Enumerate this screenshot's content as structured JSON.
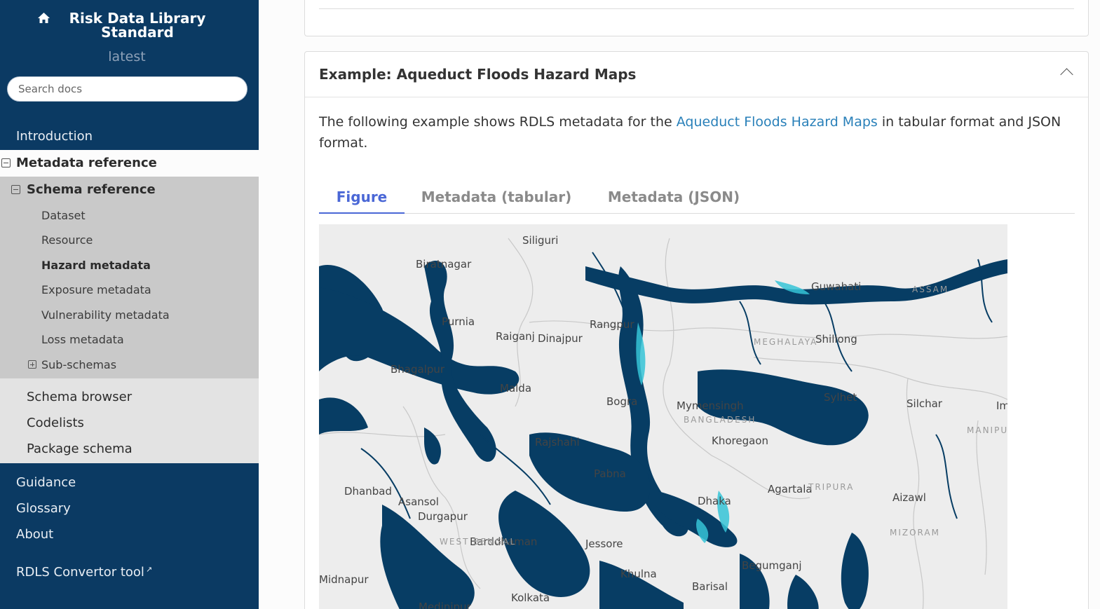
{
  "sidebar": {
    "brand": "Risk Data Library Standard",
    "version": "latest",
    "search_placeholder": "Search docs",
    "introduction": "Introduction",
    "metadata_reference": "Metadata reference",
    "schema_reference": "Schema reference",
    "schema_items": [
      "Dataset",
      "Resource",
      "Hazard metadata",
      "Exposure metadata",
      "Vulnerability metadata",
      "Loss metadata",
      "Sub-schemas"
    ],
    "reference_items": [
      "Schema browser",
      "Codelists",
      "Package schema"
    ],
    "bottom_items": [
      "Guidance",
      "Glossary",
      "About"
    ],
    "convertor": "RDLS Convertor tool"
  },
  "main": {
    "example_title": "Example: Aqueduct Floods Hazard Maps",
    "intro_before": "The following example shows RDLS metadata for the ",
    "intro_link": "Aqueduct Floods Hazard Maps",
    "intro_after": " in tabular format and JSON format.",
    "tabs": [
      "Figure",
      "Metadata (tabular)",
      "Metadata (JSON)"
    ],
    "active_tab": "Figure"
  },
  "map": {
    "labels": [
      "Siliguri",
      "Biratnagar",
      "Guwahati",
      "Purnia",
      "Raiganj",
      "Dinajpur",
      "Rangpur",
      "Shillong",
      "Bhagalpur",
      "Malda",
      "Bogra",
      "Mymensingh",
      "Sylhet",
      "Silchar",
      "Imphal",
      "Rajshahi",
      "Khoregaon",
      "Pabna",
      "Dhanbad",
      "Asansol",
      "Durgapur",
      "Agartala",
      "Aizawl",
      "Dhaka",
      "Barddhaman",
      "Jessore",
      "Khulna",
      "Begumganj",
      "Barisal",
      "Kolkata",
      "Medinipur",
      "Midnapur"
    ],
    "regions": [
      "MEGHALAYA",
      "BANGLADESH",
      "TRIPURA",
      "MIZORAM",
      "WEST BENGAL",
      "ASSAM",
      "MANIPUR"
    ],
    "colors": {
      "background": "#ededed",
      "deep_flood": "#073d64",
      "shallow_flood": "#35c3d6",
      "border": "#c8c8c8"
    }
  },
  "theme": {
    "sidebar_bg": "#0b3a63",
    "accent": "#4a67d6",
    "link": "#2980b9"
  }
}
